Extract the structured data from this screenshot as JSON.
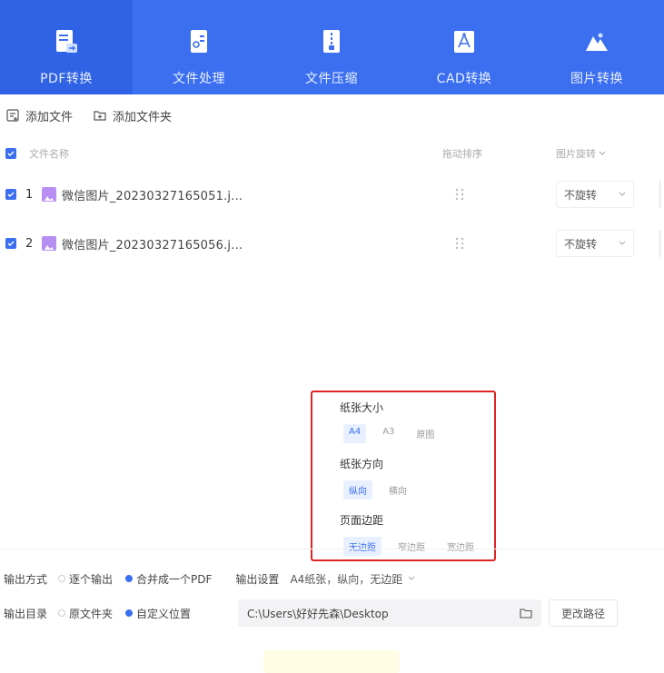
{
  "nav": {
    "items": [
      {
        "label": "PDF转换",
        "icon": "pdf-convert-icon"
      },
      {
        "label": "文件处理",
        "icon": "file-process-icon"
      },
      {
        "label": "文件压缩",
        "icon": "file-compress-icon"
      },
      {
        "label": "CAD转换",
        "icon": "cad-convert-icon"
      },
      {
        "label": "图片转换",
        "icon": "image-convert-icon"
      }
    ],
    "active_index": 0
  },
  "toolbar": {
    "add_file": "添加文件",
    "add_folder": "添加文件夹"
  },
  "table": {
    "headers": {
      "name": "文件名称",
      "sort": "拖动排序",
      "rotate": "图片旋转"
    },
    "rows": [
      {
        "index": "1",
        "name": "微信图片_20230327165051.j...",
        "rotate": "不旋转"
      },
      {
        "index": "2",
        "name": "微信图片_20230327165056.j...",
        "rotate": "不旋转"
      }
    ]
  },
  "popup": {
    "paper_size": {
      "title": "纸张大小",
      "options": [
        "A4",
        "A3",
        "原图"
      ],
      "selected": "A4"
    },
    "orientation": {
      "title": "纸张方向",
      "options": [
        "纵向",
        "横向"
      ],
      "selected": "纵向"
    },
    "margin": {
      "title": "页面边距",
      "options": [
        "无边距",
        "窄边距",
        "宽边距"
      ],
      "selected": "无边距"
    }
  },
  "output": {
    "mode_label": "输出方式",
    "mode_options": [
      "逐个输出",
      "合并成一个PDF"
    ],
    "mode_selected": "合并成一个PDF",
    "settings_label": "输出设置",
    "settings_value": "A4纸张，纵向，无边距",
    "dir_label": "输出目录",
    "dir_options": [
      "原文件夹",
      "自定义位置"
    ],
    "dir_selected": "自定义位置",
    "path": "C:\\Users\\好好先森\\Desktop",
    "change_button": "更改路径"
  },
  "colors": {
    "primary": "#3b6ff0",
    "highlight_border": "#e02424"
  }
}
